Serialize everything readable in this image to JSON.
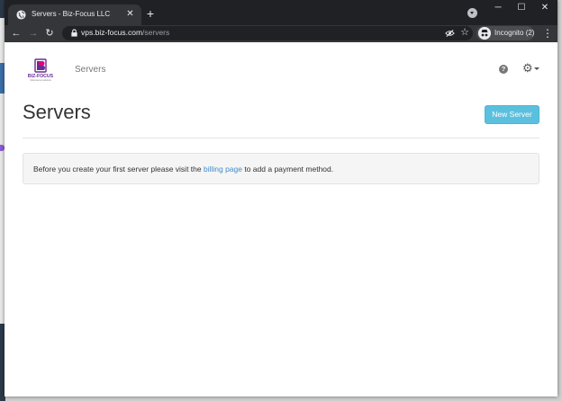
{
  "browser": {
    "tab": {
      "title": "Servers - Biz-Focus LLC",
      "close_glyph": "✕",
      "favicon": "globe-icon"
    },
    "new_tab_glyph": "+",
    "window_controls": {
      "minimize": "─",
      "maximize": "☐",
      "close": "✕"
    },
    "nav": {
      "back": "←",
      "forward": "→",
      "reload": "↻"
    },
    "url": {
      "host": "vps.biz-focus.com",
      "path": "/servers"
    },
    "star_glyph": "☆",
    "incognito_label": "Incognito (2)",
    "menu_glyph": "⋮"
  },
  "site": {
    "logo_text": "BIZ-FOCUS",
    "logo_sub": "Cloud server solutions",
    "nav_link": "Servers",
    "help_glyph": "?",
    "gear_glyph": "⚙"
  },
  "main": {
    "title": "Servers",
    "new_server_label": "New Server",
    "notice": {
      "before": "Before you create your first server please visit the ",
      "link": "billing page",
      "after": " to add a payment method."
    }
  },
  "colors": {
    "accent": "#5bc0de",
    "link": "#428bca",
    "chrome_dark": "#202124",
    "chrome_toolbar": "#35363a",
    "logo_purple": "#6a2c91",
    "logo_pink": "#e6007e"
  }
}
